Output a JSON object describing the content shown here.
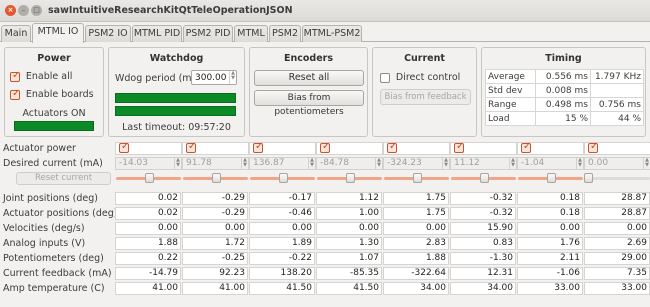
{
  "window": {
    "title": "sawIntuitiveResearchKitQtTeleOperationJSON"
  },
  "tabs": [
    {
      "label": "Main",
      "active": false
    },
    {
      "label": "MTML IO",
      "active": true
    },
    {
      "label": "PSM2 IO",
      "active": false
    },
    {
      "label": "MTML PID",
      "active": false
    },
    {
      "label": "PSM2 PID",
      "active": false
    },
    {
      "label": "MTML",
      "active": false
    },
    {
      "label": "PSM2",
      "active": false
    },
    {
      "label": "MTML-PSM2",
      "active": false
    }
  ],
  "power": {
    "title": "Power",
    "enable_all": "Enable all",
    "enable_boards": "Enable boards",
    "actuators_on": "Actuators ON"
  },
  "watchdog": {
    "title": "Watchdog",
    "period_label": "Wdog period (ms)",
    "period_value": "300.00",
    "last_timeout": "Last timeout: 09:57:20"
  },
  "encoders": {
    "title": "Encoders",
    "reset_all": "Reset all",
    "bias_pot": "Bias from potentiometers"
  },
  "current": {
    "title": "Current",
    "direct_control": "Direct control",
    "bias_feedback": "Bias from feedback"
  },
  "timing": {
    "title": "Timing",
    "rows": [
      {
        "label": "Average",
        "v1": "0.556",
        "u1": "ms",
        "v2": "1.797",
        "u2": "KHz"
      },
      {
        "label": "Std dev",
        "v1": "0.008",
        "u1": "ms",
        "v2": "",
        "u2": ""
      },
      {
        "label": "Range",
        "v1": "0.498",
        "u1": "ms",
        "v2": "0.756",
        "u2": "ms"
      },
      {
        "label": "Load",
        "v1": "15",
        "u1": "%",
        "v2": "44",
        "u2": "%"
      }
    ]
  },
  "grid": {
    "actuator_power_label": "Actuator power",
    "desired_current_label": "Desired current (mA)",
    "reset_current": "Reset current",
    "desired_current": [
      "-14.03",
      "91.78",
      "136.87",
      "-84.78",
      "-324.23",
      "11.12",
      "-1.04",
      "0.00"
    ],
    "rows": [
      {
        "label": "Joint positions (deg)",
        "values": [
          "0.02",
          "-0.29",
          "-0.17",
          "1.12",
          "1.75",
          "-0.32",
          "0.18",
          "28.87"
        ]
      },
      {
        "label": "Actuator positions (deg)",
        "values": [
          "0.02",
          "-0.29",
          "-0.46",
          "1.00",
          "1.75",
          "-0.32",
          "0.18",
          "28.87"
        ]
      },
      {
        "label": "Velocities (deg/s)",
        "values": [
          "0.00",
          "0.00",
          "0.00",
          "0.00",
          "0.00",
          "15.90",
          "0.00",
          "0.00"
        ]
      },
      {
        "label": "Analog inputs (V)",
        "values": [
          "1.88",
          "1.72",
          "1.89",
          "1.30",
          "2.83",
          "0.83",
          "1.76",
          "2.69"
        ]
      },
      {
        "label": "Potentiometers (deg)",
        "values": [
          "0.22",
          "-0.25",
          "-0.22",
          "1.07",
          "1.88",
          "-1.30",
          "2.11",
          "29.00"
        ]
      },
      {
        "label": "Current feedback (mA)",
        "values": [
          "-14.79",
          "92.23",
          "138.20",
          "-85.35",
          "-322.64",
          "12.31",
          "-1.06",
          "7.35"
        ]
      },
      {
        "label": "Amp temperature (C)",
        "values": [
          "41.00",
          "41.00",
          "41.50",
          "41.50",
          "34.00",
          "34.00",
          "33.00",
          "33.00"
        ]
      }
    ]
  }
}
